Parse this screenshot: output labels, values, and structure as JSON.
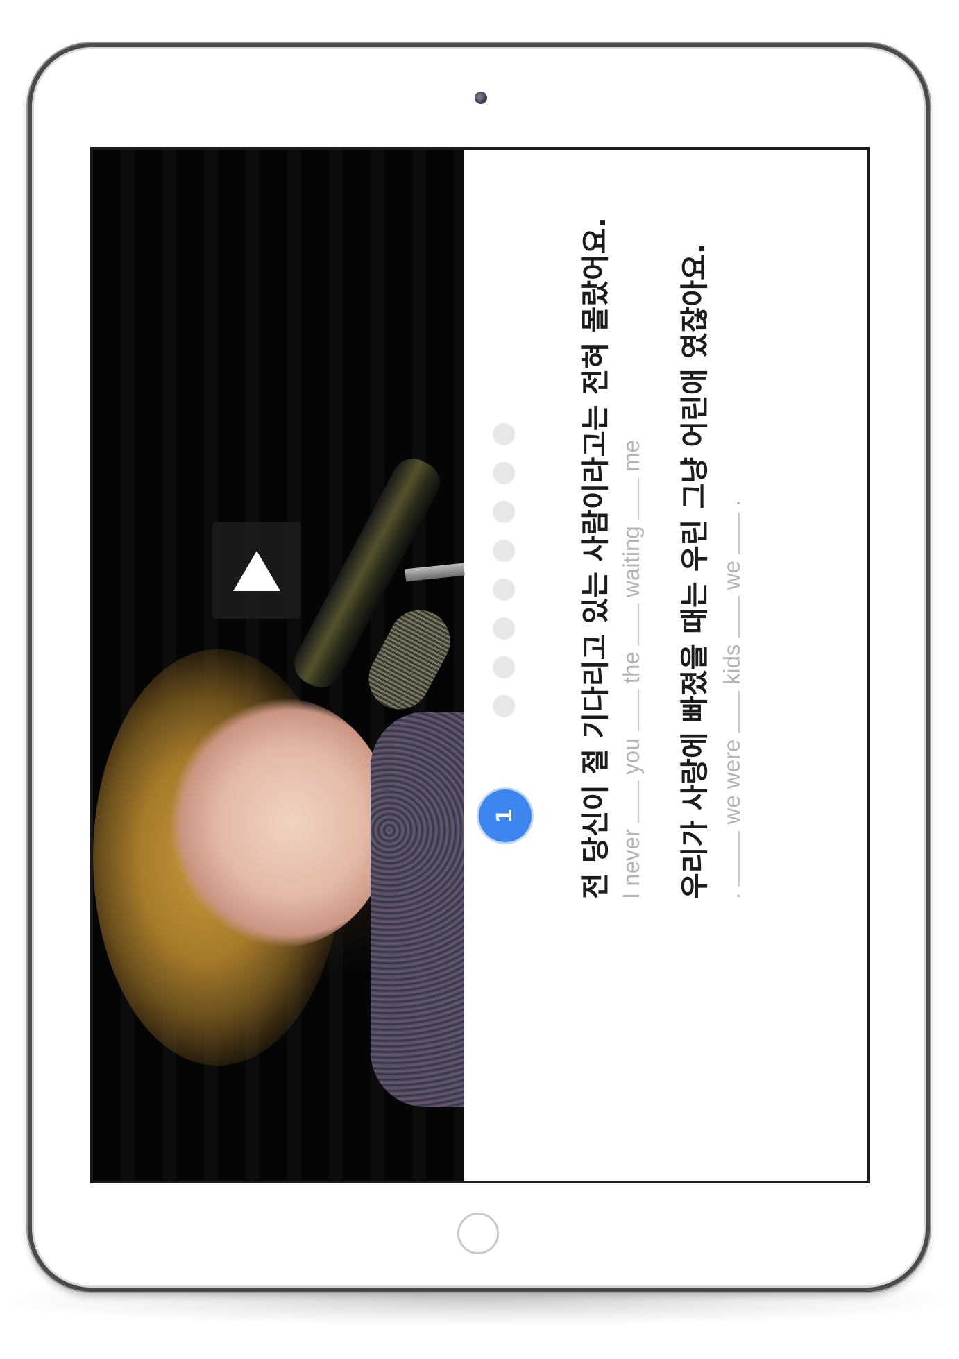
{
  "lesson": {
    "current_page": "1",
    "total_dots": 8,
    "lines": [
      {
        "korean": "전 당신이 절 기다리고 있는 사람이라고는 전혀 몰랐어요.",
        "blanks_text": [
          "I never",
          "you",
          "the",
          "waiting",
          "me"
        ]
      },
      {
        "korean": "우리가 사랑에 빠졌을 때는 우린 그냥 어린애 였잖아요.",
        "blanks_text": [
          ".",
          "we were",
          "kids",
          "we",
          "."
        ]
      }
    ]
  },
  "theme": {
    "accent": "#3d86f0",
    "dot_inactive": "#e7e7e7"
  },
  "icons": {
    "play": "play-icon"
  }
}
